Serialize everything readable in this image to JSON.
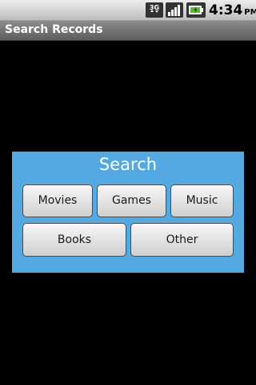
{
  "status_bar": {
    "network_label": "3G",
    "time": "4:34",
    "ampm": "PM",
    "icons": [
      "3g-icon",
      "signal-icon",
      "battery-charging-icon"
    ]
  },
  "app": {
    "title": "Search Records"
  },
  "search_panel": {
    "heading": "Search",
    "background_color": "#55a9e2",
    "buttons": {
      "movies": "Movies",
      "games": "Games",
      "music": "Music",
      "books": "Books",
      "other": "Other"
    }
  }
}
